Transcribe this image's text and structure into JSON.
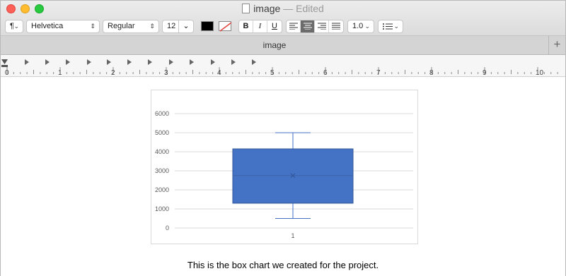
{
  "window": {
    "title": "image",
    "status": "— Edited",
    "tab_label": "image",
    "tab_add": "+"
  },
  "toolbar": {
    "paragraph_style": "¶",
    "font_family": "Helvetica",
    "font_style": "Regular",
    "font_size": "12",
    "text_color": "#000000",
    "bold": "B",
    "italic": "I",
    "underline": "U",
    "alignment_selected": "center",
    "line_spacing": "1.0"
  },
  "ruler": {
    "labels": [
      "0",
      "1",
      "2",
      "3",
      "4",
      "5",
      "6",
      "7",
      "8",
      "9",
      "10"
    ]
  },
  "document": {
    "caption": "This is the box chart we created for the project."
  },
  "chart_data": {
    "type": "box",
    "categories": [
      "1"
    ],
    "box": {
      "min": 500,
      "q1": 1300,
      "median": 2750,
      "mean": 2750,
      "q3": 4150,
      "max": 5000
    },
    "ylim": [
      0,
      6000
    ],
    "yticks": [
      "0",
      "1000",
      "2000",
      "3000",
      "4000",
      "5000",
      "6000"
    ],
    "grid": true,
    "colors": {
      "box": "#4472c4",
      "border": "#2f5597",
      "whisker": "#4472c4",
      "grid": "#d9d9d9"
    }
  }
}
